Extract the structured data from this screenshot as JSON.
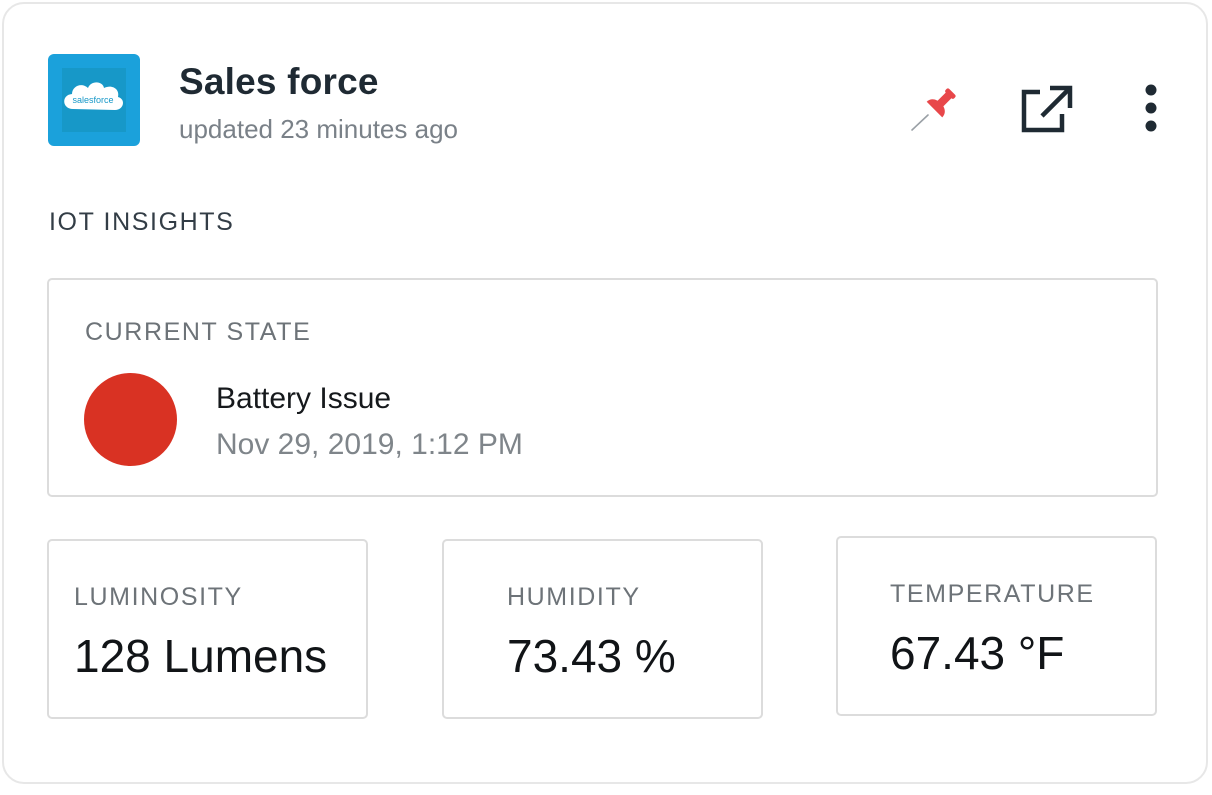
{
  "header": {
    "logo_text": "salesforce",
    "title": "Sales force",
    "subtitle": "updated 23 minutes ago",
    "actions": [
      "pin-icon",
      "external-link-icon",
      "more-vertical-icon"
    ]
  },
  "section": {
    "title": "IOT INSIGHTS"
  },
  "current_state": {
    "label": "CURRENT STATE",
    "status": "Battery Issue",
    "timestamp": "Nov 29, 2019, 1:12 PM",
    "status_color": "#d93223"
  },
  "metrics": [
    {
      "label": "LUMINOSITY",
      "value": "128 Lumens"
    },
    {
      "label": "HUMIDITY",
      "value": "73.43 %"
    },
    {
      "label": "TEMPERATURE",
      "value": "67.43 °F"
    }
  ],
  "colors": {
    "brand": "#1ba1db",
    "pin": "#e8474a",
    "title": "#1f2a33",
    "muted": "#7a8188"
  }
}
